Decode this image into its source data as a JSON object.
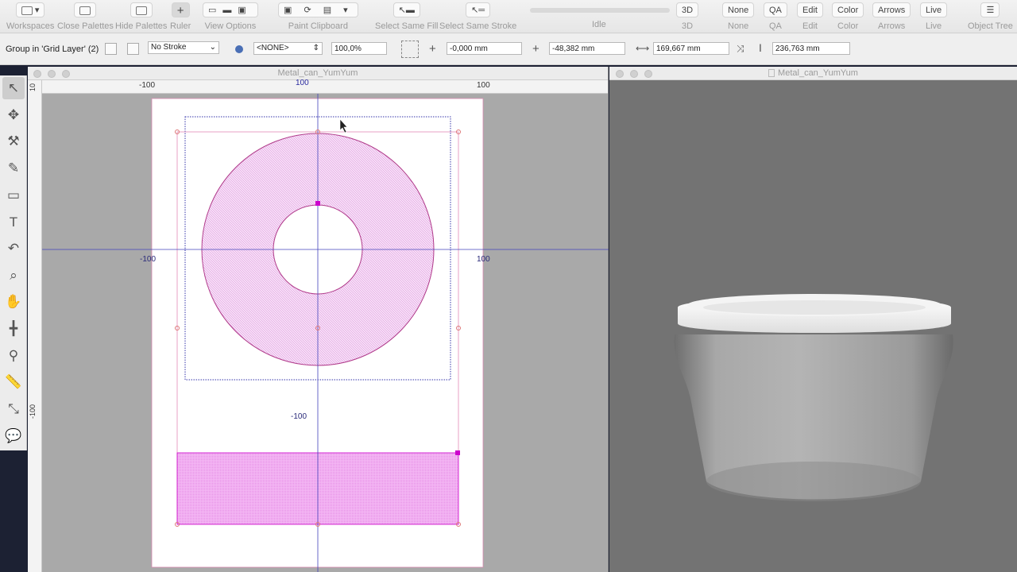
{
  "toolbar": {
    "workspaces": "Workspaces",
    "close_palettes": "Close Palettes",
    "hide_palettes": "Hide Palettes",
    "ruler": "Ruler",
    "view_options": "View Options",
    "paint_clipboard": "Paint Clipboard",
    "select_same_fill": "Select Same Fill",
    "select_same_stroke": "Select Same Stroke",
    "status": "Idle",
    "btn_3d": "3D",
    "lbl_3d": "3D",
    "btn_none": "None",
    "lbl_none": "None",
    "btn_qa": "QA",
    "lbl_qa": "QA",
    "btn_edit": "Edit",
    "lbl_edit": "Edit",
    "btn_color": "Color",
    "lbl_color": "Color",
    "btn_arrows": "Arrows",
    "lbl_arrows": "Arrows",
    "btn_live": "Live",
    "lbl_live": "Live",
    "object_tree": "Object Tree"
  },
  "propbar": {
    "selection": "Group in 'Grid Layer' (2)",
    "stroke": "No Stroke",
    "style": "<NONE>",
    "opacity": "100,0%",
    "x": "-0,000 mm",
    "y": "-48,382 mm",
    "width": "169,667 mm",
    "height": "236,763 mm"
  },
  "drawing_window": {
    "title": "Metal_can_YumYum",
    "ruler_top": [
      "-100",
      "100",
      "100"
    ],
    "ruler_left": [
      "10",
      "-100"
    ],
    "axis_labels": {
      "x_neg": "-100",
      "x_pos": "100",
      "y_neg": "-100"
    }
  },
  "preview_window": {
    "title": "Metal_can_YumYum"
  },
  "colors": {
    "accent_magenta": "#cc00cc",
    "guide_blue": "#3333aa",
    "canvas_gray": "#a9a9a9",
    "preview_gray": "#737373"
  }
}
